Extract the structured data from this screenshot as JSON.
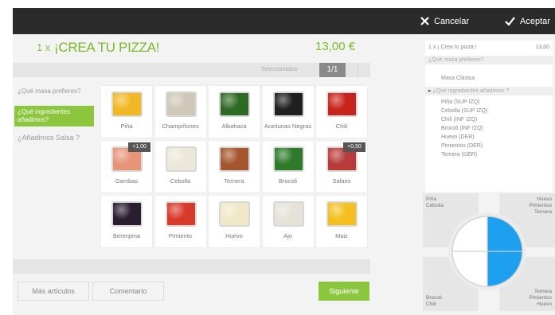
{
  "topbar": {
    "cancel_label": "Cancelar",
    "accept_label": "Aceptar"
  },
  "product": {
    "qty": "1 x",
    "name": "¡CREA TU PIZZA!",
    "price": "13,00 €"
  },
  "selector": {
    "label": "Seleccionados",
    "count": "1/1"
  },
  "questions": [
    {
      "label": "¿Qué masa prefieres?",
      "active": false
    },
    {
      "label": "¿Qué ingredientes añadimos?",
      "active": true
    },
    {
      "label": "¿Añadimos Salsa ?",
      "active": false
    }
  ],
  "ingredients": [
    {
      "label": "Piña",
      "icon": "pineapple-icon",
      "color": "#f2b824",
      "tag": ""
    },
    {
      "label": "Champiñones",
      "icon": "mushroom-icon",
      "color": "#cfc8b8",
      "tag": ""
    },
    {
      "label": "Albahaca",
      "icon": "basil-icon",
      "color": "#2f6a24",
      "tag": ""
    },
    {
      "label": "Aceitunas Negras",
      "icon": "olive-icon",
      "color": "#202020",
      "tag": ""
    },
    {
      "label": "Chili",
      "icon": "chili-icon",
      "color": "#c8241c",
      "tag": ""
    },
    {
      "label": "Gambas",
      "icon": "shrimp-icon",
      "color": "#e89478",
      "tag": "+1,00"
    },
    {
      "label": "Cebolla",
      "icon": "onion-icon",
      "color": "#ece8d8",
      "tag": ""
    },
    {
      "label": "Ternera",
      "icon": "beef-icon",
      "color": "#a5562e",
      "tag": ""
    },
    {
      "label": "Brocoli",
      "icon": "broccoli-icon",
      "color": "#2e7a2a",
      "tag": ""
    },
    {
      "label": "Salami",
      "icon": "salami-icon",
      "color": "#b83a3a",
      "tag": "+0,50"
    },
    {
      "label": "Berenjena",
      "icon": "eggplant-icon",
      "color": "#2a1e2e",
      "tag": ""
    },
    {
      "label": "Pimiento",
      "icon": "pepper-icon",
      "color": "#d83a2a",
      "tag": ""
    },
    {
      "label": "Huevo",
      "icon": "egg-icon",
      "color": "#f0e8c8",
      "tag": ""
    },
    {
      "label": "Ajo",
      "icon": "garlic-icon",
      "color": "#e6e2d8",
      "tag": ""
    },
    {
      "label": "Maiz",
      "icon": "corn-icon",
      "color": "#f4c020",
      "tag": ""
    }
  ],
  "buttons": {
    "more_label": "Más artículos",
    "comment_label": "Comentario",
    "next_label": "Siguiente"
  },
  "order": {
    "head": "1 x ¡ Crea tu pizza !",
    "price": "13,00",
    "q1": "¿Qué masa prefieres?",
    "dough": "Masa Clásica",
    "q2": "¿Qué ingredientes añadimos ?",
    "lines": [
      "Piña (SUP IZQ)",
      "Cebolla (SUP IZQ)",
      "Chili (INF IZQ)",
      "Brocoli (INF IZQ)",
      "Huevo (DER)",
      "Pimientos (DER)",
      "Ternera (DER)"
    ]
  },
  "pizza_quadrants": {
    "top_left": [
      "Piña",
      "Cebolla"
    ],
    "top_right": [
      "Huevo",
      "Pimientos",
      "Ternera"
    ],
    "bottom_left": [
      "Brocoli",
      "Chili"
    ],
    "bottom_right": [
      "Ternera",
      "Pimientos",
      "Huevo"
    ]
  },
  "colors": {
    "accent_green": "#8cc63f",
    "pizza_selected": "#1ea0f0",
    "topbar": "#2b2b2b"
  }
}
